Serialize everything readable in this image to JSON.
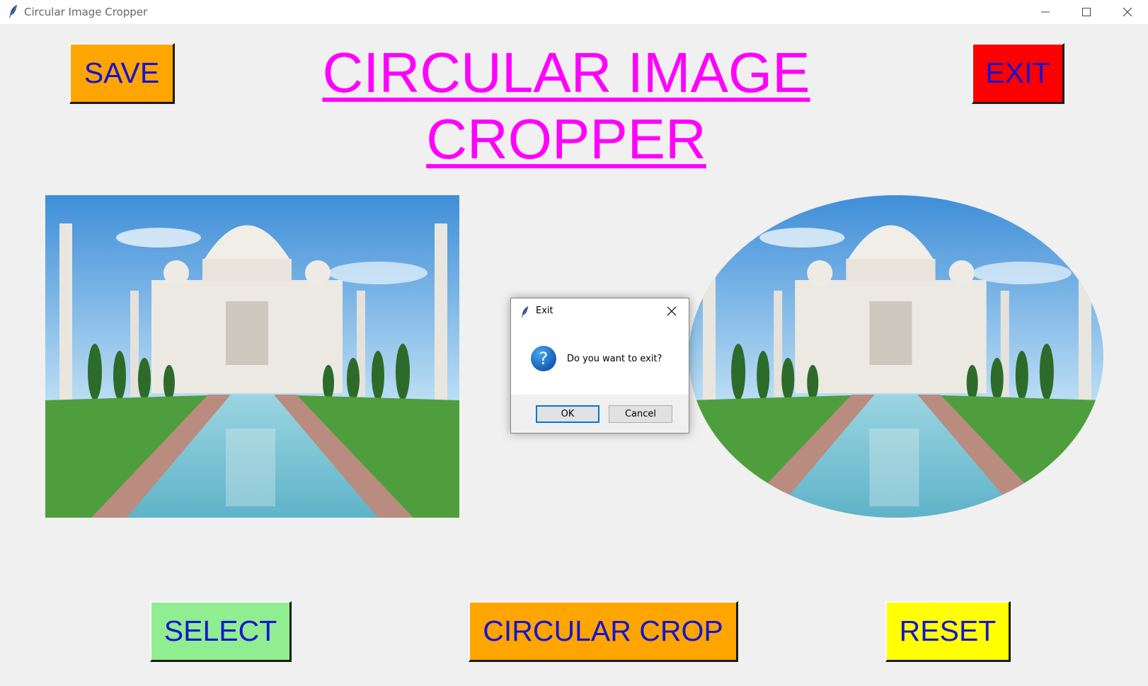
{
  "window": {
    "title": "Circular Image Cropper",
    "icon": "feather-icon"
  },
  "heading": {
    "line1": "CIRCULAR IMAGE",
    "line2": "CROPPER",
    "color": "#ff00ff"
  },
  "buttons": {
    "save": {
      "label": "SAVE",
      "color": "#ffa500"
    },
    "exit": {
      "label": "EXIT",
      "color": "#ff0000"
    },
    "select": {
      "label": "SELECT",
      "color": "#90ee90"
    },
    "circular_crop": {
      "label": "CIRCULAR CROP",
      "color": "#ffa500"
    },
    "reset": {
      "label": "RESET",
      "color": "#ffff00"
    },
    "text_color": "#1414d2"
  },
  "images": {
    "original": "Taj Mahal photo",
    "cropped": "Taj Mahal photo (elliptical crop)"
  },
  "dialog": {
    "title": "Exit",
    "message": "Do you want to exit?",
    "icon": "question-icon",
    "ok_label": "OK",
    "cancel_label": "Cancel"
  }
}
